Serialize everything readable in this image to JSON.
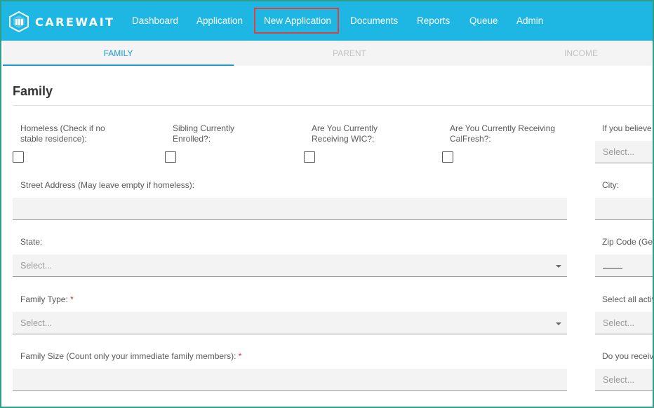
{
  "brand": {
    "name": "CAREWAIT"
  },
  "nav": {
    "items": [
      {
        "label": "Dashboard"
      },
      {
        "label": "Application"
      },
      {
        "label": "New Application"
      },
      {
        "label": "Documents"
      },
      {
        "label": "Reports"
      },
      {
        "label": "Queue"
      },
      {
        "label": "Admin"
      }
    ]
  },
  "tabs": [
    {
      "label": "FAMILY",
      "active": true
    },
    {
      "label": "PARENT",
      "active": false
    },
    {
      "label": "INCOME",
      "active": false
    }
  ],
  "section": {
    "title": "Family"
  },
  "checkboxes": [
    {
      "label": "Homeless (Check if no stable residence):",
      "checked": false
    },
    {
      "label": "Sibling Currently Enrolled?:",
      "checked": false
    },
    {
      "label": "Are You Currently Receiving WIC?:",
      "checked": false
    },
    {
      "label": "Are You Currently Receiving CalFresh?:",
      "checked": false
    }
  ],
  "right_column": {
    "if_you_believe": {
      "label": "If you believe",
      "placeholder": "Select..."
    },
    "city": {
      "label": "City:"
    },
    "zip": {
      "label": "Zip Code (Ger"
    },
    "select_all": {
      "label": "Select all activ",
      "placeholder": "Select..."
    },
    "do_you_receive": {
      "label": "Do you receive",
      "placeholder": "Select..."
    }
  },
  "fields": {
    "street": {
      "label": "Street Address (May leave empty if homeless):",
      "value": ""
    },
    "state": {
      "label": "State:",
      "placeholder": "Select..."
    },
    "family_type": {
      "label": "Family Type:",
      "required_mark": "*",
      "placeholder": "Select..."
    },
    "family_size": {
      "label": "Family Size (Count only your immediate family members):",
      "required_mark": "*",
      "value": ""
    }
  },
  "colors": {
    "nav_bg": "#1eb7e3",
    "accent": "#1c9bd1",
    "highlight": "#e0403f",
    "required": "#d1372e"
  }
}
